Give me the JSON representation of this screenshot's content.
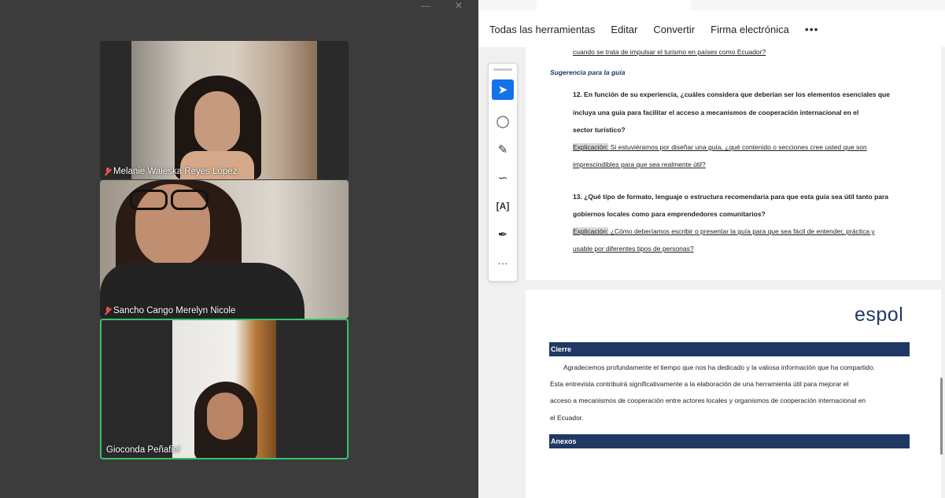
{
  "participants": [
    {
      "name": "Melanie Waleska Reyes López",
      "muted": true
    },
    {
      "name": "Sancho Cango Merelyn Nicole",
      "muted": true
    },
    {
      "name": "Gioconda Peñafiel",
      "muted": false
    }
  ],
  "viewer": {
    "menu": {
      "all_tools": "Todas las herramientas",
      "edit": "Editar",
      "convert": "Convertir",
      "esign": "Firma electrónica",
      "more": "•••"
    },
    "tools_more": "···"
  },
  "document": {
    "prev_line": "cuando se trata de impulsar el turismo en países como Ecuador?",
    "section_heading": "Sugerencia para la guía",
    "q12": {
      "line1": "12. En función de su experiencia, ¿cuáles considera que deberían ser los elementos esenciales que",
      "line2": "incluya una guía para facilitar el acceso a mecanismos de cooperación internacional en el",
      "line3": "sector turístico?",
      "expl_label": "Explicación:",
      "expl_line1": " Si estuviéramos por diseñar una guía, ¿qué contenido o secciones cree usted que son",
      "expl_line2": "imprescindibles para que sea realmente útil?"
    },
    "q13": {
      "line1": "13. ¿Qué tipo de formato, lenguaje o estructura recomendaría para que esta guía sea útil tanto para",
      "line2": "gobiernos locales como para emprendedores comunitarios?",
      "expl_label": "Explicación:",
      "expl_line1": " ¿Cómo deberíamos escribir o presentar la guía para que sea fácil de entender, práctica y",
      "expl_line2": "usable por diferentes tipos de personas?"
    },
    "logo": "espol",
    "cierre": {
      "title": "Cierre",
      "lines": [
        "Agradecemos profundamente el tiempo que nos ha dedicado y la valiosa información que ha compartido.",
        "Esta entrevista contribuirá significativamente a la elaboración de una herramienta útil para mejorar el",
        "acceso a mecanismos de cooperación entre actores locales y organismos de cooperación internacional en",
        "el Ecuador."
      ]
    },
    "anexos_title": "Anexos"
  },
  "colors": {
    "accent": "#1473e6",
    "doc_bar": "#1f3864",
    "active_speaker": "#36c26a",
    "muted_mic": "#e8554a"
  }
}
